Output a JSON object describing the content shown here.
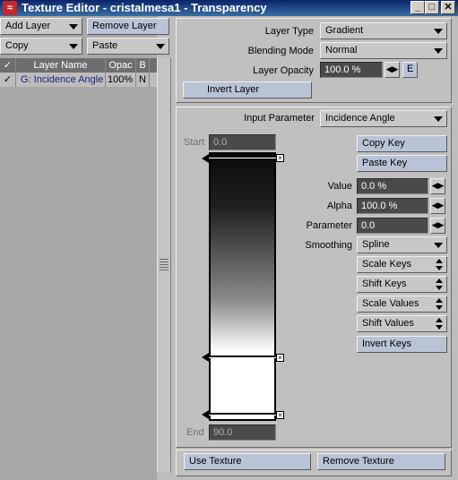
{
  "window": {
    "title": "Texture Editor - cristalmesa1 - Transparency",
    "minimize": "_",
    "maximize": "□",
    "close": "✕"
  },
  "left": {
    "add_layer": "Add Layer",
    "remove_layer": "Remove Layer",
    "copy": "Copy",
    "paste": "Paste",
    "columns": {
      "check": "✓",
      "name": "Layer Name",
      "opac": "Opac",
      "blend": "B"
    },
    "rows": [
      {
        "check": "✓",
        "name": "G: Incidence Angle",
        "opac": "100%",
        "blend": "N"
      }
    ]
  },
  "top": {
    "layer_type_label": "Layer Type",
    "layer_type_value": "Gradient",
    "blending_mode_label": "Blending Mode",
    "blending_mode_value": "Normal",
    "layer_opacity_label": "Layer Opacity",
    "layer_opacity_value": "100.0 %",
    "envelope_button": "E",
    "invert_layer": "Invert Layer"
  },
  "gradient": {
    "input_parameter_label": "Input Parameter",
    "input_parameter_value": "Incidence Angle",
    "start_label": "Start",
    "start_value": "0.0",
    "end_label": "End",
    "end_value": "90.0",
    "copy_key": "Copy Key",
    "paste_key": "Paste Key",
    "value_label": "Value",
    "value_value": "0.0 %",
    "alpha_label": "Alpha",
    "alpha_value": "100.0 %",
    "parameter_label": "Parameter",
    "parameter_value": "0.0",
    "smoothing_label": "Smoothing",
    "smoothing_value": "Spline",
    "scale_keys": "Scale Keys",
    "shift_keys": "Shift Keys",
    "scale_values": "Scale Values",
    "shift_values": "Shift Values",
    "invert_keys": "Invert Keys"
  },
  "bottom": {
    "use_texture": "Use Texture",
    "remove_texture": "Remove Texture"
  }
}
